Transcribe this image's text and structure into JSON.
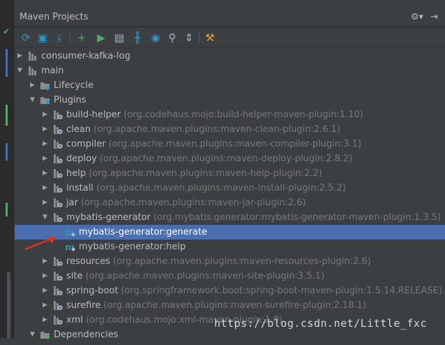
{
  "window": {
    "title": "Maven Projects",
    "title_icons": [
      "gear-icon",
      "hide-icon"
    ]
  },
  "toolbar": {
    "buttons": [
      {
        "name": "reimport-button",
        "glyph": "⟳",
        "color": "#3592c4"
      },
      {
        "name": "generate-sources-button",
        "glyph": "▣",
        "color": "#3592c4"
      },
      {
        "name": "download-button",
        "glyph": "⤓",
        "color": "#3592c4"
      },
      {
        "name": "add-project-button",
        "glyph": "+",
        "color": "#59a869"
      },
      {
        "name": "run-button",
        "glyph": "▶",
        "color": "#59a869"
      },
      {
        "name": "execute-goal-button",
        "glyph": "▤",
        "color": "#a9b7c6"
      },
      {
        "name": "toggle-offline-button",
        "glyph": "╫",
        "color": "#3592c4"
      },
      {
        "name": "skip-tests-button",
        "glyph": "◉",
        "color": "#3592c4"
      },
      {
        "name": "show-dependencies-button",
        "glyph": "⚲",
        "color": "#a9b7c6"
      },
      {
        "name": "collapse-all-button",
        "glyph": "⇕",
        "color": "#a9b7c6"
      },
      {
        "name": "settings-button",
        "glyph": "⚒",
        "color": "#e0a040"
      }
    ]
  },
  "tree": {
    "rows": [
      {
        "level": 0,
        "arrow": "▶",
        "icon": "maven-module-icon",
        "label": "consumer-kafka-log",
        "detail": ""
      },
      {
        "level": 0,
        "arrow": "▼",
        "icon": "maven-module-icon",
        "label": "main",
        "detail": ""
      },
      {
        "level": 1,
        "arrow": "▶",
        "icon": "lifecycle-folder-icon",
        "label": "Lifecycle",
        "detail": ""
      },
      {
        "level": 1,
        "arrow": "▼",
        "icon": "plugins-folder-icon",
        "label": "Plugins",
        "detail": ""
      },
      {
        "level": 2,
        "arrow": "▶",
        "icon": "plugin-icon",
        "label": "build-helper",
        "detail": "(org.codehaus.mojo:build-helper-maven-plugin:1.10)"
      },
      {
        "level": 2,
        "arrow": "▶",
        "icon": "plugin-icon",
        "label": "clean",
        "detail": "(org.apache.maven.plugins:maven-clean-plugin:2.6.1)"
      },
      {
        "level": 2,
        "arrow": "▶",
        "icon": "plugin-icon",
        "label": "compiler",
        "detail": "(org.apache.maven.plugins:maven-compiler-plugin:3.1)"
      },
      {
        "level": 2,
        "arrow": "▶",
        "icon": "plugin-icon",
        "label": "deploy",
        "detail": "(org.apache.maven.plugins:maven-deploy-plugin:2.8.2)"
      },
      {
        "level": 2,
        "arrow": "▶",
        "icon": "plugin-icon",
        "label": "help",
        "detail": "(org.apache.maven.plugins:maven-help-plugin:2.2)"
      },
      {
        "level": 2,
        "arrow": "▶",
        "icon": "plugin-icon",
        "label": "install",
        "detail": "(org.apache.maven.plugins:maven-install-plugin:2.5.2)"
      },
      {
        "level": 2,
        "arrow": "▶",
        "icon": "plugin-icon",
        "label": "jar",
        "detail": "(org.apache.maven.plugins:maven-jar-plugin:2.6)"
      },
      {
        "level": 2,
        "arrow": "▼",
        "icon": "plugin-icon",
        "label": "mybatis-generator",
        "detail": "(org.mybatis.generator:mybatis-generator-maven-plugin:1.3.5)"
      },
      {
        "level": 3,
        "arrow": "",
        "icon": "goal-icon",
        "label": "mybatis-generator:generate",
        "detail": "",
        "selected": true
      },
      {
        "level": 3,
        "arrow": "",
        "icon": "goal-icon",
        "label": "mybatis-generator:help",
        "detail": ""
      },
      {
        "level": 2,
        "arrow": "▶",
        "icon": "plugin-icon",
        "label": "resources",
        "detail": "(org.apache.maven.plugins:maven-resources-plugin:2.6)"
      },
      {
        "level": 2,
        "arrow": "▶",
        "icon": "plugin-icon",
        "label": "site",
        "detail": "(org.apache.maven.plugins:maven-site-plugin:3.5.1)"
      },
      {
        "level": 2,
        "arrow": "▶",
        "icon": "plugin-icon",
        "label": "spring-boot",
        "detail": "(org.springframework.boot:spring-boot-maven-plugin:1.5.14.RELEASE)"
      },
      {
        "level": 2,
        "arrow": "▶",
        "icon": "plugin-icon",
        "label": "surefire",
        "detail": "(org.apache.maven.plugins:maven-surefire-plugin:2.18.1)"
      },
      {
        "level": 2,
        "arrow": "▶",
        "icon": "plugin-icon",
        "label": "xml",
        "detail": "(org.codehaus.mojo:xml-maven-plugin:1.0)"
      },
      {
        "level": 1,
        "arrow": "▼",
        "icon": "dependencies-folder-icon",
        "label": "Dependencies",
        "detail": ""
      }
    ]
  },
  "watermark": "https://blog.csdn.net/Little_fxc",
  "colors": {
    "selection": "#4b6eaf",
    "annotation_arrow": "#e03020"
  }
}
